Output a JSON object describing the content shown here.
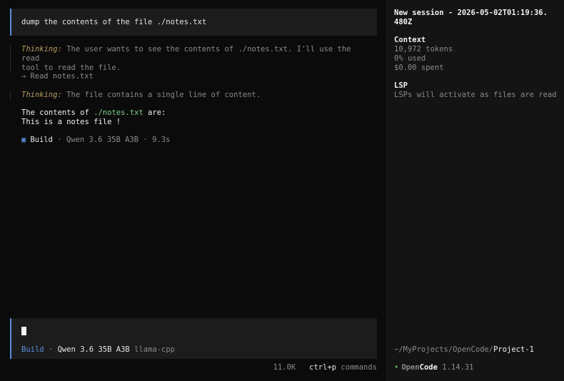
{
  "chat": {
    "user_message": "dump the contents of the file ./notes.txt",
    "thinking_1": {
      "label": "Thinking:",
      "text": "The user wants to see the contents of ./notes.txt. I'll use the read\ntool to read the file."
    },
    "tool_call": {
      "arrow": "→",
      "text": "Read notes.txt"
    },
    "thinking_2": {
      "label": "Thinking:",
      "text": "The file contains a single line of content."
    },
    "answer": {
      "prefix": "The contents of",
      "path": "./notes.txt",
      "suffix": "are:",
      "line2": "This is a notes file !"
    },
    "build_info": {
      "icon": "square-icon",
      "mode": "Build",
      "sep1": "·",
      "model": "Qwen 3.6 35B A3B",
      "sep2": "·",
      "duration": "9.3s"
    }
  },
  "input": {
    "mode": "Build",
    "sep": "·",
    "model": "Qwen 3.6 35B A3B",
    "provider": "llama-cpp"
  },
  "footer": {
    "tokens": "11.0K",
    "key": "ctrl+p",
    "action": "commands"
  },
  "sidebar": {
    "title": "New session - 2026-05-02T01:19:36.\n480Z",
    "context": {
      "heading": "Context",
      "tokens": "10,972 tokens",
      "used": "0% used",
      "spent": "$0.00 spent"
    },
    "lsp": {
      "heading": "LSP",
      "text": "LSPs will activate as files are read"
    },
    "path_prefix": "~/MyProjects/OpenCode/",
    "path_project": "Project-1",
    "app": {
      "name_open": "Open",
      "name_code": "Code",
      "version": "1.14.31"
    },
    "colors": {
      "accent": "#5b8fd9",
      "status_dot": "#5fb86f",
      "thinking_label": "#b89a62",
      "path_highlight": "#7fd08a"
    }
  }
}
